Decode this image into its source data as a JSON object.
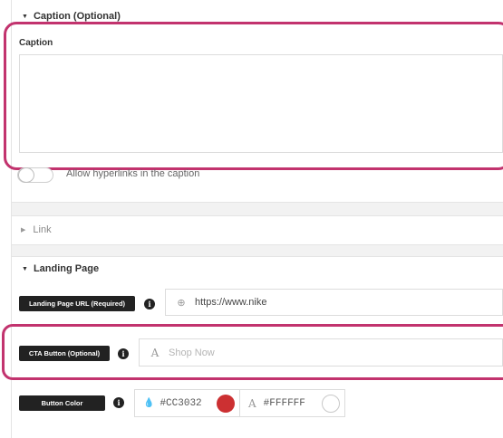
{
  "caption_section": {
    "header": "Caption (Optional)",
    "field_label": "Caption",
    "field_value": "",
    "toggle_label": "Allow hyperlinks in the caption",
    "toggle_on": false
  },
  "link_section": {
    "header": "Link",
    "expanded": false
  },
  "landing_section": {
    "header": "Landing Page",
    "url": {
      "label": "Landing Page URL (Required)",
      "info": "i",
      "icon": "globe-icon",
      "value": "https://www.nike"
    },
    "cta": {
      "label": "CTA Button (Optional)",
      "info": "i",
      "icon": "font-a-icon",
      "placeholder": "Shop Now"
    },
    "button_color": {
      "label": "Button Color",
      "info": "i",
      "bg_hex": "#CC3032",
      "text_hex": "#FFFFFF",
      "bg_swatch": "#cc3032",
      "text_swatch": "#ffffff"
    }
  },
  "glyphs": {
    "caret_down": "▼",
    "caret_right": "▶",
    "globe": "⊕",
    "font_a": "A",
    "drop": "●"
  },
  "colors": {
    "highlight": "#c2336e",
    "label_pill": "#222222"
  }
}
